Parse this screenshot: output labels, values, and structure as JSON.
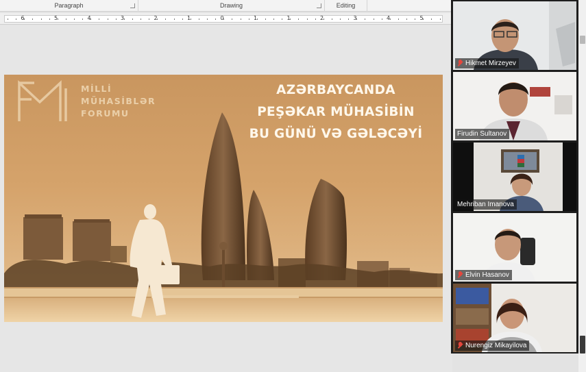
{
  "ribbon": {
    "groups": [
      "Paragraph",
      "Drawing",
      "Editing"
    ]
  },
  "ruler": {
    "labels": [
      "6",
      "5",
      "4",
      "3",
      "2",
      "1",
      "1",
      "1",
      "2",
      "3",
      "4",
      "5",
      "6"
    ],
    "center_label": "0"
  },
  "slide": {
    "logo_lines": [
      "MİLLİ",
      "MÜHASİBLƏR",
      "FORUMU"
    ],
    "title_lines": [
      "AZƏRBAYCANDA",
      "PEŞƏKAR MÜHASİBİN",
      "BU GÜNÜ VƏ GƏLƏCƏYİ"
    ],
    "tint_color": "#d5a36b"
  },
  "participants": [
    {
      "name": "Hikmet Mirzeyev",
      "muted": true,
      "active": false
    },
    {
      "name": "Firudin Sultanov",
      "muted": false,
      "active": false
    },
    {
      "name": "Mehriban Imanova",
      "muted": false,
      "active": true
    },
    {
      "name": "Elvin Hasanov",
      "muted": true,
      "active": false
    },
    {
      "name": "Nurengiz Mikayilova",
      "muted": true,
      "active": false
    }
  ]
}
